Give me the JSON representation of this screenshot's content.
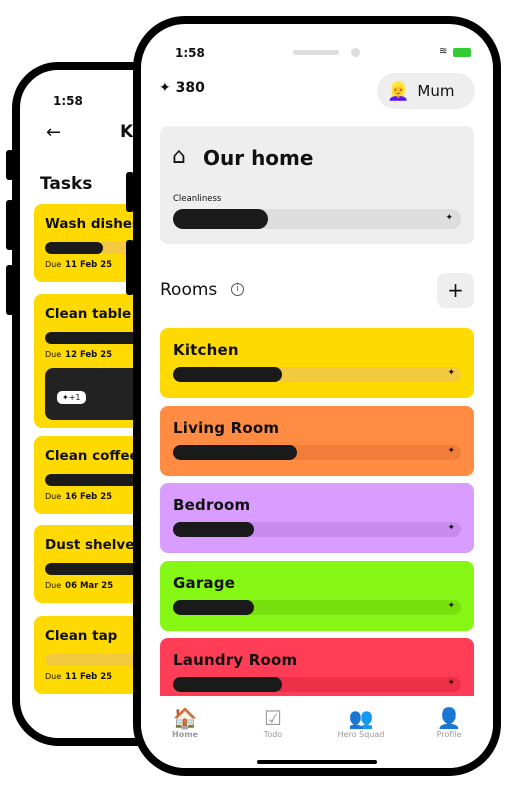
{
  "back_phone": {
    "time": "1:58",
    "title": "Ki",
    "back_icon": "arrow-left-icon",
    "section": "Tasks",
    "tasks": [
      {
        "name": "Wash dishes",
        "due_label": "Due",
        "due": "11 Feb 25",
        "progress": 0.25
      },
      {
        "name": "Clean table t",
        "due_label": "Due",
        "due": "12 Feb 25",
        "progress": 1,
        "reward": "+1"
      },
      {
        "name": "Clean coffee",
        "due_label": "Due",
        "due": "16 Feb 25",
        "progress": 1
      },
      {
        "name": "Dust shelves",
        "due_label": "Due",
        "due": "06 Mar 25",
        "progress": 1
      },
      {
        "name": "Clean tap",
        "due_label": "Due",
        "due": "11 Feb 25",
        "progress": 0
      }
    ]
  },
  "front_phone": {
    "time": "1:58",
    "points": "380",
    "user": {
      "name": "Mum",
      "avatar": "👱‍♀️"
    },
    "home": {
      "title": "Our home",
      "cleanliness_label": "Cleanliness",
      "cleanliness": 0.33
    },
    "rooms_title": "Rooms",
    "rooms": [
      {
        "name": "Kitchen",
        "color": "#FFDA00",
        "track": "#F3C93F",
        "progress": 0.38
      },
      {
        "name": "Living Room",
        "color": "#FF8C42",
        "track": "#F07E38",
        "progress": 0.43
      },
      {
        "name": "Bedroom",
        "color": "#D99CFF",
        "track": "#C88BEF",
        "progress": 0.28
      },
      {
        "name": "Garage",
        "color": "#86F614",
        "track": "#78E00E",
        "progress": 0.28
      },
      {
        "name": "Laundry Room",
        "color": "#FF3D56",
        "track": "#EE2F48",
        "progress": 0.38
      }
    ],
    "nav": [
      {
        "label": "Home",
        "icon": "🏠",
        "active": true
      },
      {
        "label": "Todo",
        "icon": "☑",
        "active": false
      },
      {
        "label": "Hero Squad",
        "icon": "👥",
        "active": false
      },
      {
        "label": "Profile",
        "icon": "👤",
        "active": false
      }
    ]
  }
}
